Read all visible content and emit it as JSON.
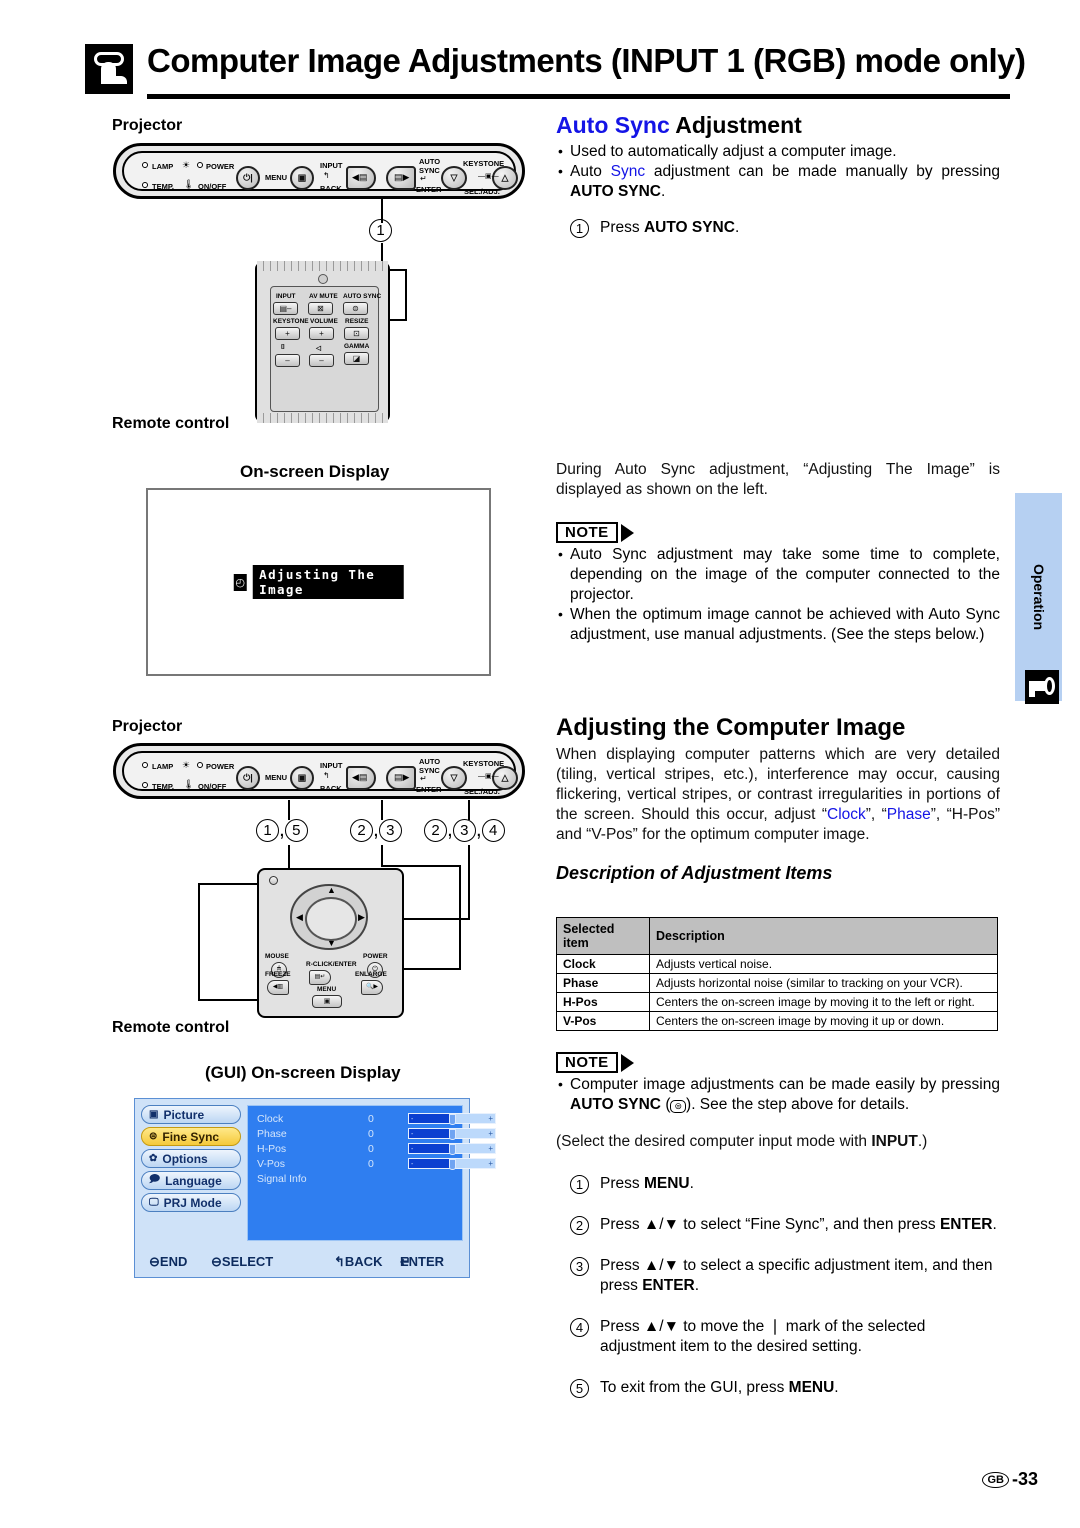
{
  "header": {
    "title": "Computer Image Adjustments (INPUT 1 (RGB) mode only)",
    "icon": "button-press-finger-icon"
  },
  "labels": {
    "projector_1": "Projector",
    "remote_control_1": "Remote control",
    "onscreen_display": "On-screen Display",
    "projector_2": "Projector",
    "remote_control_2": "Remote control",
    "gui_onscreen_display": "(GUI) On-screen Display"
  },
  "projector_panel": {
    "lamp": "LAMP",
    "temp": "TEMP.",
    "power": "POWER",
    "on_off": "ON/OFF",
    "menu": "MENU",
    "input": "INPUT",
    "back": "BACK",
    "auto": "AUTO",
    "sync": "SYNC",
    "enter": "ENTER",
    "keystone": "KEYSTONE",
    "sel_adj": "SEL./ADJ."
  },
  "remote1": {
    "input": "INPUT",
    "av_mute": "AV MUTE",
    "auto_sync": "AUTO SYNC",
    "keystone": "KEYSTONE",
    "volume": "VOLUME",
    "resize": "RESIZE",
    "gamma": "GAMMA",
    "plus": "+",
    "minus": "–"
  },
  "remote2": {
    "mouse": "MOUSE",
    "power": "POWER",
    "freeze": "FREEZE",
    "r_click_enter": "R-CLICK/ENTER",
    "enlarge": "ENLARGE",
    "menu": "MENU"
  },
  "callouts": {
    "top_panel": "1",
    "panel2_menu": "1 , 5",
    "panel2_enter": "2 , 3",
    "panel2_adj": "2 , 3 , 4"
  },
  "osd": {
    "message": "Adjusting The Image",
    "icon": "clock-icon"
  },
  "gui": {
    "tabs": [
      {
        "label": "Picture",
        "icon": "picture-icon",
        "selected": false
      },
      {
        "label": "Fine Sync",
        "icon": "fine-sync-icon",
        "selected": true
      },
      {
        "label": "Options",
        "icon": "options-icon",
        "selected": false
      },
      {
        "label": "Language",
        "icon": "language-icon",
        "selected": false
      },
      {
        "label": "PRJ Mode",
        "icon": "prj-mode-icon",
        "selected": false
      }
    ],
    "rows": [
      {
        "name": "Clock",
        "value": "0",
        "slider": true
      },
      {
        "name": "Phase",
        "value": "0",
        "slider": true
      },
      {
        "name": "H-Pos",
        "value": "0",
        "slider": true
      },
      {
        "name": "V-Pos",
        "value": "0",
        "slider": true
      },
      {
        "name": "Signal Info",
        "value": "",
        "slider": false
      }
    ],
    "footer": {
      "end": "END",
      "select": "SELECT",
      "back": "BACK",
      "enter": "ENTER"
    }
  },
  "auto_sync": {
    "heading_blue": "Auto Sync",
    "heading_rest": " Adjustment",
    "bullet_1": "Used to automatically adjust a computer image.",
    "bullet_2_a": "Auto ",
    "bullet_2_blue": "Sync",
    "bullet_2_b": " adjustment can be made manually by pressing ",
    "bullet_2_bold": "AUTO SYNC",
    "bullet_2_c": ".",
    "step_1_num": "1",
    "step_1_a": "Press ",
    "step_1_bold": "AUTO SYNC",
    "step_1_b": ".",
    "during_text": "During Auto Sync adjustment, “Adjusting The Image” is displayed as shown on the left.",
    "note_label": "NOTE",
    "note_1": "Auto Sync adjustment may take some time to complete, depending on the image of the computer connected to the projector.",
    "note_2": "When the optimum image cannot be achieved with Auto Sync adjustment, use manual adjustments. (See the steps below.)"
  },
  "adjusting": {
    "heading": "Adjusting the Computer Image",
    "para_a": "When displaying computer patterns which are very detailed (tiling, vertical stripes, etc.), interference may occur, causing flickering, vertical stripes, or contrast irregularities in portions of the screen. Should this occur, adjust “",
    "clock": "Clock",
    "para_b": "”, “",
    "phase": "Phase",
    "para_c": "”, “H-Pos” and “V-Pos” for the optimum computer image.",
    "table_heading": "Description of Adjustment Items",
    "table": {
      "columns": [
        "Selected item",
        "Description"
      ],
      "rows": [
        [
          "Clock",
          "Adjusts vertical noise."
        ],
        [
          "Phase",
          "Adjusts horizontal noise (similar to tracking on your VCR)."
        ],
        [
          "H-Pos",
          "Centers the on-screen image by moving it to the left or right."
        ],
        [
          "V-Pos",
          "Centers the on-screen image by moving it up or down."
        ]
      ]
    },
    "note_label": "NOTE",
    "note_1_a": "Computer image adjustments can be made easily by pressing ",
    "note_1_bold": "AUTO SYNC",
    "note_1_b": " (",
    "note_1_c": "). See the step above for details.",
    "select_input_a": "(Select the desired computer input mode with ",
    "select_input_bold": "INPUT",
    "select_input_b": ".)",
    "steps": [
      {
        "num": "1",
        "a": "Press ",
        "bold": "MENU",
        "b": "."
      },
      {
        "num": "2",
        "a": "Press ▲/▼ to select “Fine Sync”, and then press ",
        "bold": "ENTER",
        "b": "."
      },
      {
        "num": "3",
        "a": "Press ▲/▼ to select a specific adjustment item, and then press ",
        "bold": "ENTER",
        "b": "."
      },
      {
        "num": "4",
        "a": "Press ▲/▼ to move the ❘ mark of the selected adjustment item to the desired setting.",
        "bold": "",
        "b": ""
      },
      {
        "num": "5",
        "a": "To exit from the GUI, press ",
        "bold": "MENU",
        "b": "."
      }
    ]
  },
  "sidetab": {
    "label": "Operation",
    "icon": "key-icon"
  },
  "footer": {
    "region": "GB",
    "page": "-33"
  },
  "colors": {
    "accent_blue": "#1414e6",
    "gui_panel_blue": "#2f7ef0",
    "gui_bg": "#cfe2f8",
    "selected_tab": "#f5c93b",
    "sidetab_bg": "#b6d0f2"
  }
}
